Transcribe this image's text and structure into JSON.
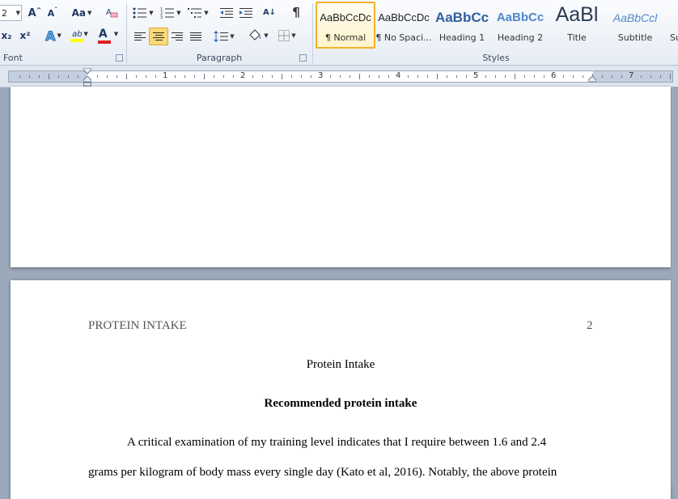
{
  "ribbon": {
    "font_group": {
      "label": "Font",
      "font_size": "2",
      "grow_font_glyph": "A",
      "shrink_font_glyph": "A",
      "change_case_label": "Aa",
      "subscript_label": "x₂",
      "superscript_label": "x²",
      "text_effects_glyph": "A",
      "highlight_glyph": "ab",
      "font_color_glyph": "A",
      "highlight_color": "#ffff00",
      "font_color": "#e02020"
    },
    "paragraph_group": {
      "label": "Paragraph",
      "sort_glyph": "A↓",
      "pilcrow_glyph": "¶"
    },
    "styles_group": {
      "label": "Styles",
      "items": [
        {
          "preview": "AaBbCcDc",
          "name": "¶ Normal",
          "selected": true
        },
        {
          "preview": "AaBbCcDc",
          "name": "¶ No Spaci..."
        },
        {
          "preview": "AaBbCc",
          "name": "Heading 1"
        },
        {
          "preview": "AaBbCc",
          "name": "Heading 2"
        },
        {
          "preview": "AaBl",
          "name": "Title"
        },
        {
          "preview": "AaBbCcl",
          "name": "Subtitle"
        },
        {
          "preview": "",
          "name": "Su"
        }
      ]
    }
  },
  "ruler": {
    "numbers": [
      "1",
      "2",
      "3",
      "4",
      "5",
      "6",
      "7"
    ]
  },
  "document": {
    "header_title": "PROTEIN INTAKE",
    "page_number": "2",
    "title": "Protein Intake",
    "heading": "Recommended protein intake",
    "paragraph_line_1": "A critical examination of my training level indicates that I require between 1.6 and 2.4",
    "paragraph_line_2": "grams per kilogram of body mass every single  day (Kato et al, 2016). Notably, the above protein"
  }
}
